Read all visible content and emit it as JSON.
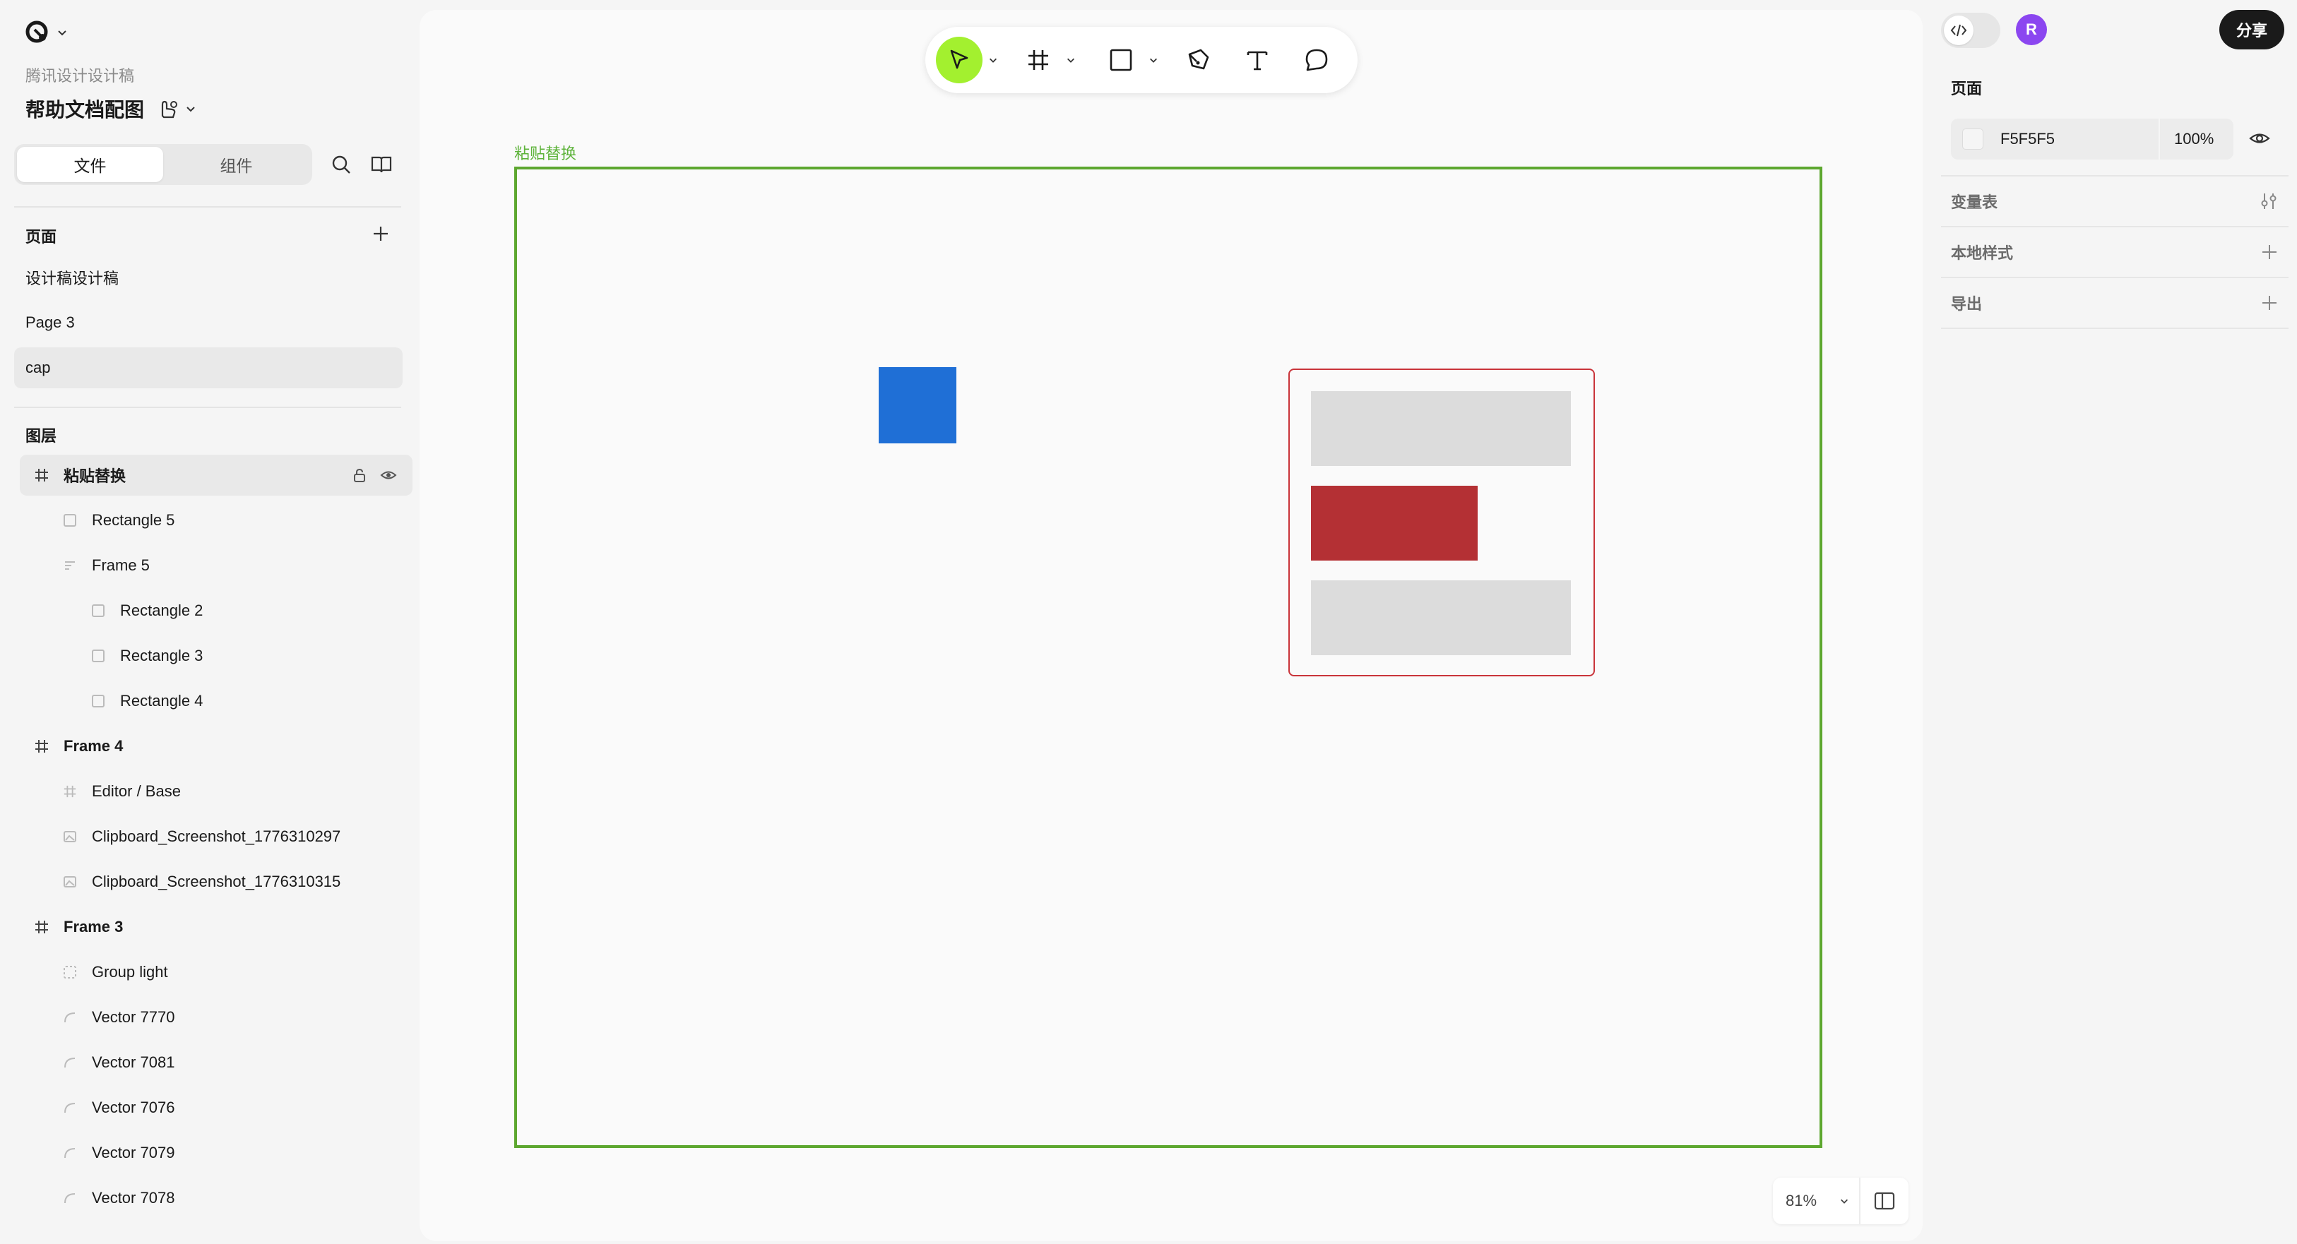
{
  "left": {
    "team": "腾讯设计设计稿",
    "doc_title": "帮助文档配图",
    "tabs": [
      "文件",
      "组件"
    ],
    "pages_title": "页面",
    "pages": [
      "设计稿设计稿",
      "Page 3",
      "cap"
    ],
    "layers_title": "图层",
    "layers": [
      {
        "label": "粘贴替换",
        "icon": "frame-icon"
      },
      {
        "label": "Rectangle 5",
        "icon": "rectangle-icon"
      },
      {
        "label": "Frame 5",
        "icon": "auto-layout-icon"
      },
      {
        "label": "Rectangle 2",
        "icon": "rectangle-icon"
      },
      {
        "label": "Rectangle 3",
        "icon": "rectangle-icon"
      },
      {
        "label": "Rectangle 4",
        "icon": "rectangle-icon"
      },
      {
        "label": "Frame 4",
        "icon": "frame-icon"
      },
      {
        "label": "Editor / Base",
        "icon": "frame-icon"
      },
      {
        "label": "Clipboard_Screenshot_1776310297",
        "icon": "image-icon"
      },
      {
        "label": "Clipboard_Screenshot_1776310315",
        "icon": "image-icon"
      },
      {
        "label": "Frame 3",
        "icon": "frame-icon"
      },
      {
        "label": "Group light",
        "icon": "group-icon"
      },
      {
        "label": "Vector 7770",
        "icon": "vector-icon"
      },
      {
        "label": "Vector 7081",
        "icon": "vector-icon"
      },
      {
        "label": "Vector 7076",
        "icon": "vector-icon"
      },
      {
        "label": "Vector 7079",
        "icon": "vector-icon"
      },
      {
        "label": "Vector 7078",
        "icon": "vector-icon"
      }
    ]
  },
  "canvas": {
    "frame_label": "粘贴替换",
    "zoom": "81%",
    "tools": [
      "move-tool",
      "frame-tool",
      "rectangle-tool",
      "pen-tool",
      "text-tool",
      "comment-tool"
    ]
  },
  "right": {
    "avatar_initial": "R",
    "share_label": "分享",
    "page_section": "页面",
    "page_fill_hex": "F5F5F5",
    "page_fill_opacity": "100%",
    "variables_label": "变量表",
    "local_styles_label": "本地样式",
    "export_label": "导出"
  },
  "colors": {
    "accent_green": "#a3f02f",
    "frame_green": "#5da72f",
    "blue": "#1f6fd6",
    "red": "#b43034",
    "avatar_purple": "#8b46f0"
  }
}
